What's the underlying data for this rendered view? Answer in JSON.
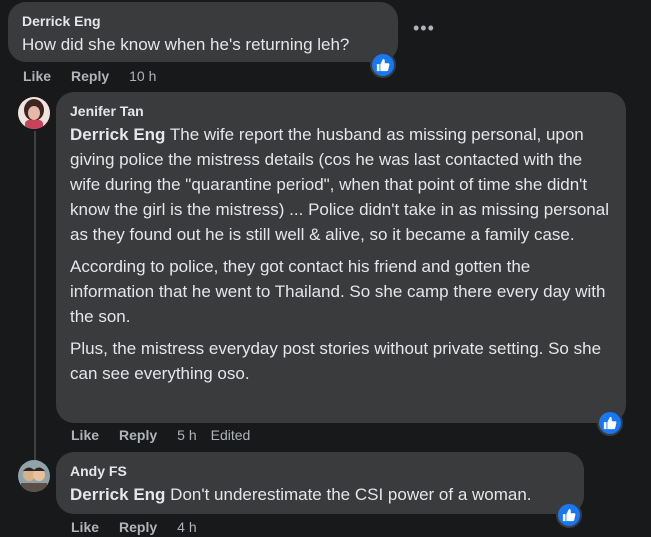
{
  "comments": [
    {
      "author": "Derrick Eng",
      "text": "How did she know when he's returning leh?",
      "actions": {
        "like": "Like",
        "reply": "Reply",
        "time": "10 h"
      }
    },
    {
      "author": "Jenifer Tan",
      "mention": "Derrick Eng",
      "paragraphs": [
        " The wife report the husband as missing personal, upon giving police the mistress details (cos he was last contacted with the wife during the \"quarantine period\", when that point of time she didn't know the girl is the mistress) ... Police didn't take in as missing personal as they found out he is still well & alive, so it became a family case.",
        "According to police, they got contact his friend and gotten the information that he went to Thailand. So she camp there every day with the son.",
        "Plus, the mistress everyday post stories without private setting. So she can see everything oso."
      ],
      "actions": {
        "like": "Like",
        "reply": "Reply",
        "time": "5 h",
        "edited": "Edited"
      }
    },
    {
      "author": "Andy FS",
      "mention": "Derrick Eng",
      "text": " Don't underestimate the CSI power of a woman.",
      "actions": {
        "like": "Like",
        "reply": "Reply",
        "time": "4 h"
      }
    }
  ],
  "icons": {
    "more": "more-options-icon",
    "like_reaction": "thumbs-up-icon"
  },
  "colors": {
    "background": "#18191a",
    "bubble": "#3a3b3c",
    "text": "#e4e6eb",
    "secondary": "#b0b3b8",
    "like_blue": "#1877f2"
  }
}
